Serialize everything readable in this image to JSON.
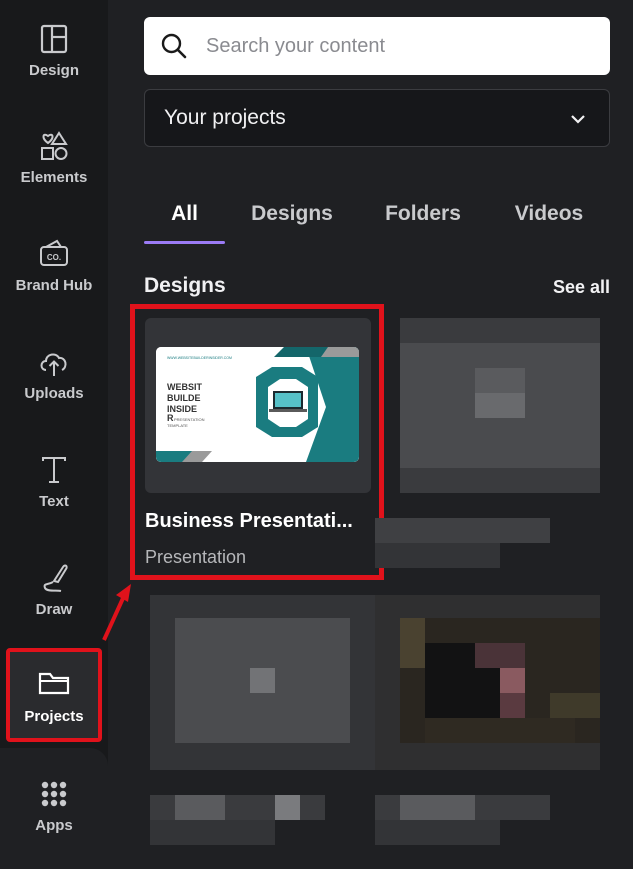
{
  "sidebar": {
    "items": [
      {
        "label": "Design",
        "icon": "layout-icon"
      },
      {
        "label": "Elements",
        "icon": "shapes-icon"
      },
      {
        "label": "Brand Hub",
        "icon": "brand-hub-icon"
      },
      {
        "label": "Uploads",
        "icon": "cloud-upload-icon"
      },
      {
        "label": "Text",
        "icon": "text-icon"
      },
      {
        "label": "Draw",
        "icon": "draw-icon"
      },
      {
        "label": "Projects",
        "icon": "folder-icon"
      },
      {
        "label": "Apps",
        "icon": "apps-grid-icon"
      }
    ],
    "active": "Projects",
    "brand_badge": "CO."
  },
  "search": {
    "placeholder": "Search your content",
    "value": ""
  },
  "filter": {
    "selected": "Your projects"
  },
  "tabs": [
    {
      "label": "All",
      "active": true
    },
    {
      "label": "Designs",
      "active": false
    },
    {
      "label": "Folders",
      "active": false
    },
    {
      "label": "Videos",
      "active": false
    }
  ],
  "designs": {
    "section_title": "Designs",
    "see_all": "See all",
    "items": [
      {
        "title": "Business Presentati...",
        "type": "Presentation",
        "thumbnail_lines": [
          "WEBSIT",
          "BUILDE",
          "INSIDE",
          "R"
        ],
        "thumbnail_caption": [
          "PRESENTATION",
          "TEMPLATE"
        ]
      }
    ]
  },
  "colors": {
    "highlight": "#e0121b",
    "accent_tab": "#9b7bf5",
    "teal": "#1a7c80"
  }
}
